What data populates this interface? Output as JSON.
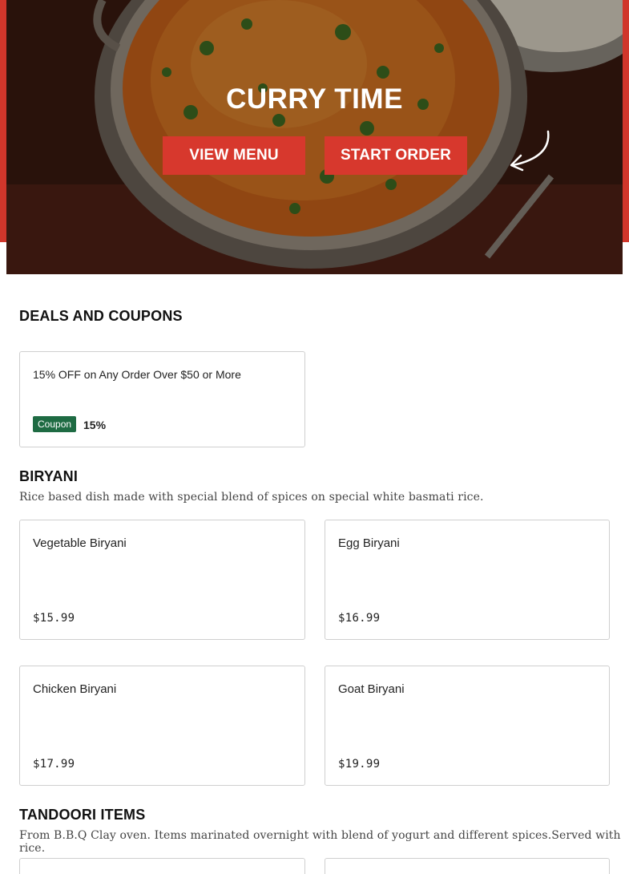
{
  "hero": {
    "title": "CURRY TIME",
    "view_menu_label": "VIEW MENU",
    "start_order_label": "START ORDER"
  },
  "deals": {
    "title": "DEALS AND COUPONS",
    "items": [
      {
        "title": "15% OFF on Any Order Over $50 or More",
        "badge": "Coupon",
        "value": "15%"
      }
    ]
  },
  "biryani": {
    "title": "BIRYANI",
    "description": "Rice based dish made with special blend of spices on special white basmati rice.",
    "items": [
      {
        "name": "Vegetable Biryani",
        "price": "$15.99"
      },
      {
        "name": "Egg Biryani",
        "price": "$16.99"
      },
      {
        "name": "Chicken Biryani",
        "price": "$17.99"
      },
      {
        "name": "Goat Biryani",
        "price": "$19.99"
      }
    ]
  },
  "tandoori": {
    "title": "TANDOORI ITEMS",
    "description": "From B.B.Q Clay oven. Items marinated overnight with blend of yogurt and different spices.Served with rice."
  },
  "colors": {
    "brand_red": "#d7382d",
    "coupon_green": "#1e6b43"
  }
}
